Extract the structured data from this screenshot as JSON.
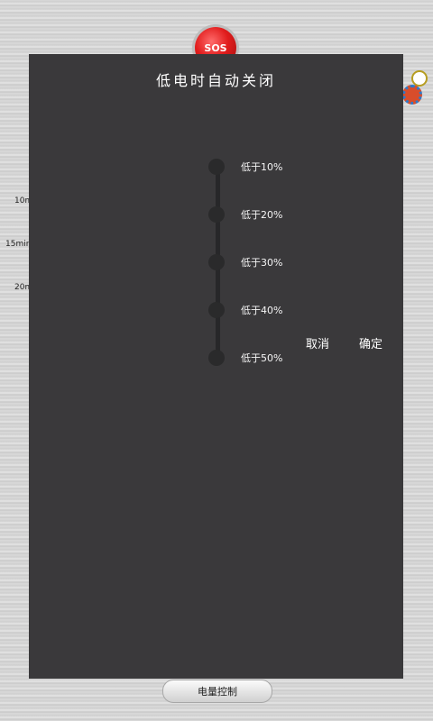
{
  "background": {
    "time_labels": [
      "10m",
      "15min",
      "20m"
    ],
    "sos_label": "SOS"
  },
  "dialog": {
    "title": "低电时自动关闭",
    "options": [
      "低于10%",
      "低于20%",
      "低于30%",
      "低于40%",
      "低于50%"
    ],
    "cancel": "取消",
    "confirm": "确定"
  },
  "bottom_button": "电量控制",
  "icons": [
    "clock-icon",
    "gear-icon"
  ]
}
